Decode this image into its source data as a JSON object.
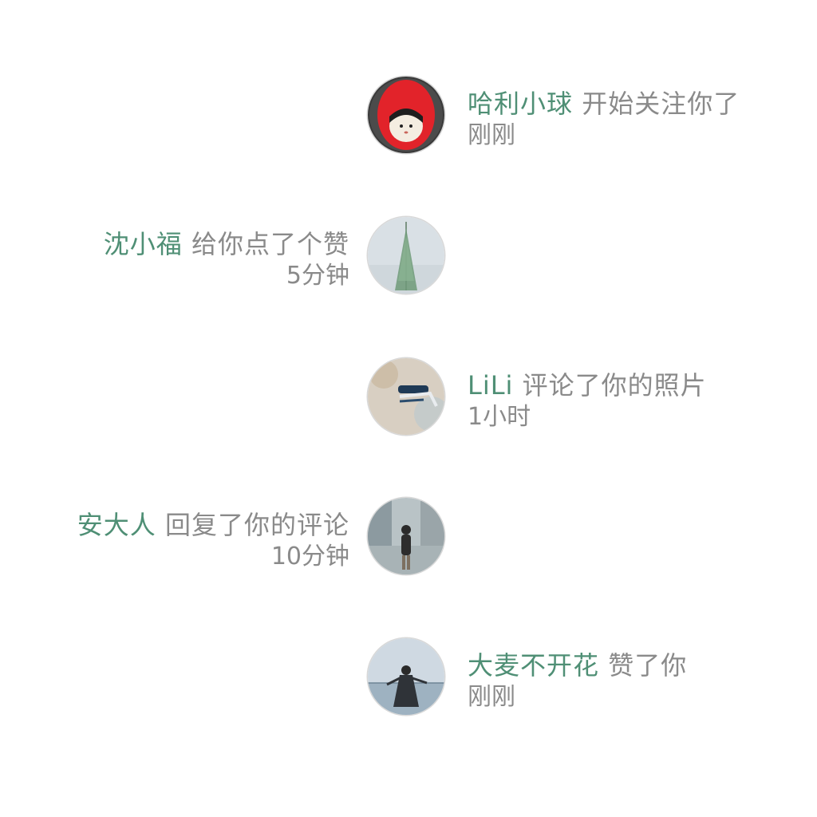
{
  "colors": {
    "username": "#4f8f75",
    "text": "#8a8a8a",
    "background": "#ffffff"
  },
  "notifications": [
    {
      "user": "哈利小球",
      "action": "开始关注你了",
      "time": "刚刚",
      "side": "right",
      "avatar": "red-hood-avatar"
    },
    {
      "user": "沈小福",
      "action": "给你点了个赞",
      "time": "5分钟",
      "side": "left",
      "avatar": "pine-tree-avatar"
    },
    {
      "user": "LiLi",
      "action": "评论了你的照片",
      "time": "1小时",
      "side": "right",
      "avatar": "bicycle-avatar"
    },
    {
      "user": "安大人",
      "action": "回复了你的评论",
      "time": "10分钟",
      "side": "left",
      "avatar": "street-photo-avatar"
    },
    {
      "user": "大麦不开花",
      "action": "赞了你",
      "time": "刚刚",
      "side": "right",
      "avatar": "seaside-photo-avatar"
    }
  ]
}
